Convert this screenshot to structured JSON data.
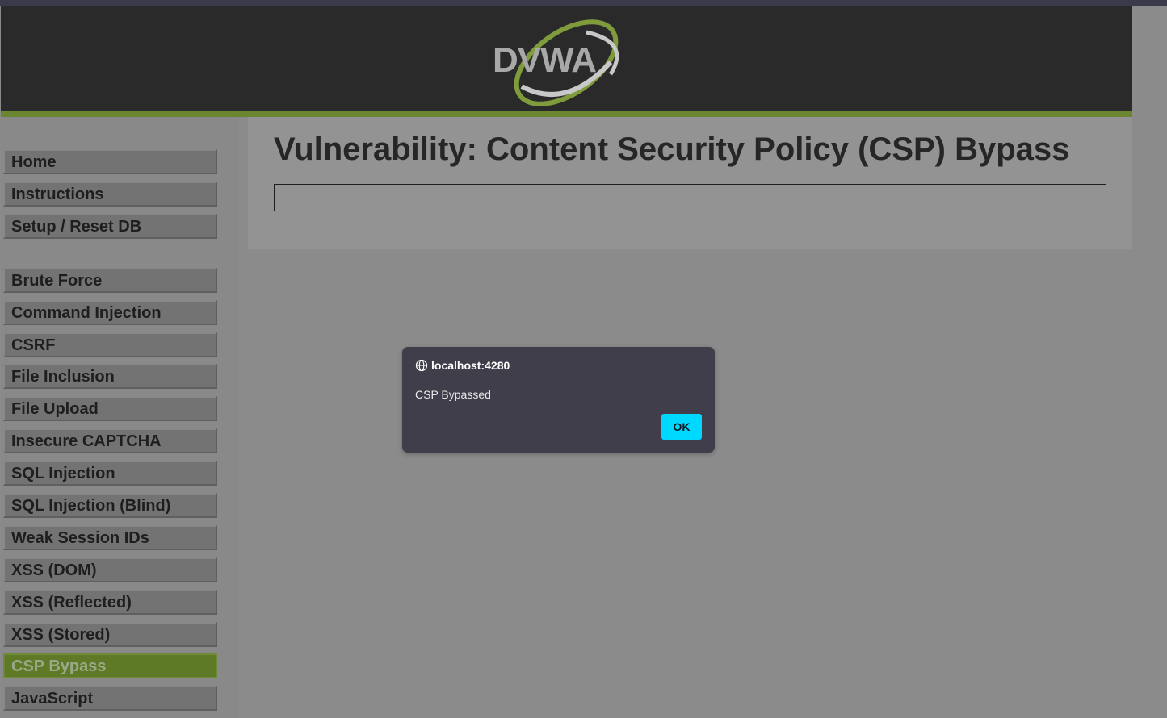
{
  "header": {
    "logo_text": "DVWA"
  },
  "menu": {
    "group1": [
      {
        "label": "Home"
      },
      {
        "label": "Instructions"
      },
      {
        "label": "Setup / Reset DB"
      }
    ],
    "group2": [
      {
        "label": "Brute Force"
      },
      {
        "label": "Command Injection"
      },
      {
        "label": "CSRF"
      },
      {
        "label": "File Inclusion"
      },
      {
        "label": "File Upload"
      },
      {
        "label": "Insecure CAPTCHA"
      },
      {
        "label": "SQL Injection"
      },
      {
        "label": "SQL Injection (Blind)"
      },
      {
        "label": "Weak Session IDs"
      },
      {
        "label": "XSS (DOM)"
      },
      {
        "label": "XSS (Reflected)"
      },
      {
        "label": "XSS (Stored)"
      },
      {
        "label": "CSP Bypass",
        "active": true
      },
      {
        "label": "JavaScript"
      }
    ]
  },
  "main": {
    "title": "Vulnerability: Content Security Policy (CSP) Bypass"
  },
  "dialog": {
    "origin": "localhost:4280",
    "message": "CSP Bypassed",
    "ok_label": "OK"
  },
  "colors": {
    "header_bg": "#2a2a2a",
    "accent_green": "#6b8530",
    "dialog_bg": "#3f3e4a",
    "ok_button": "#00d9ff"
  },
  "icons": {
    "dialog_origin": "globe-icon"
  }
}
